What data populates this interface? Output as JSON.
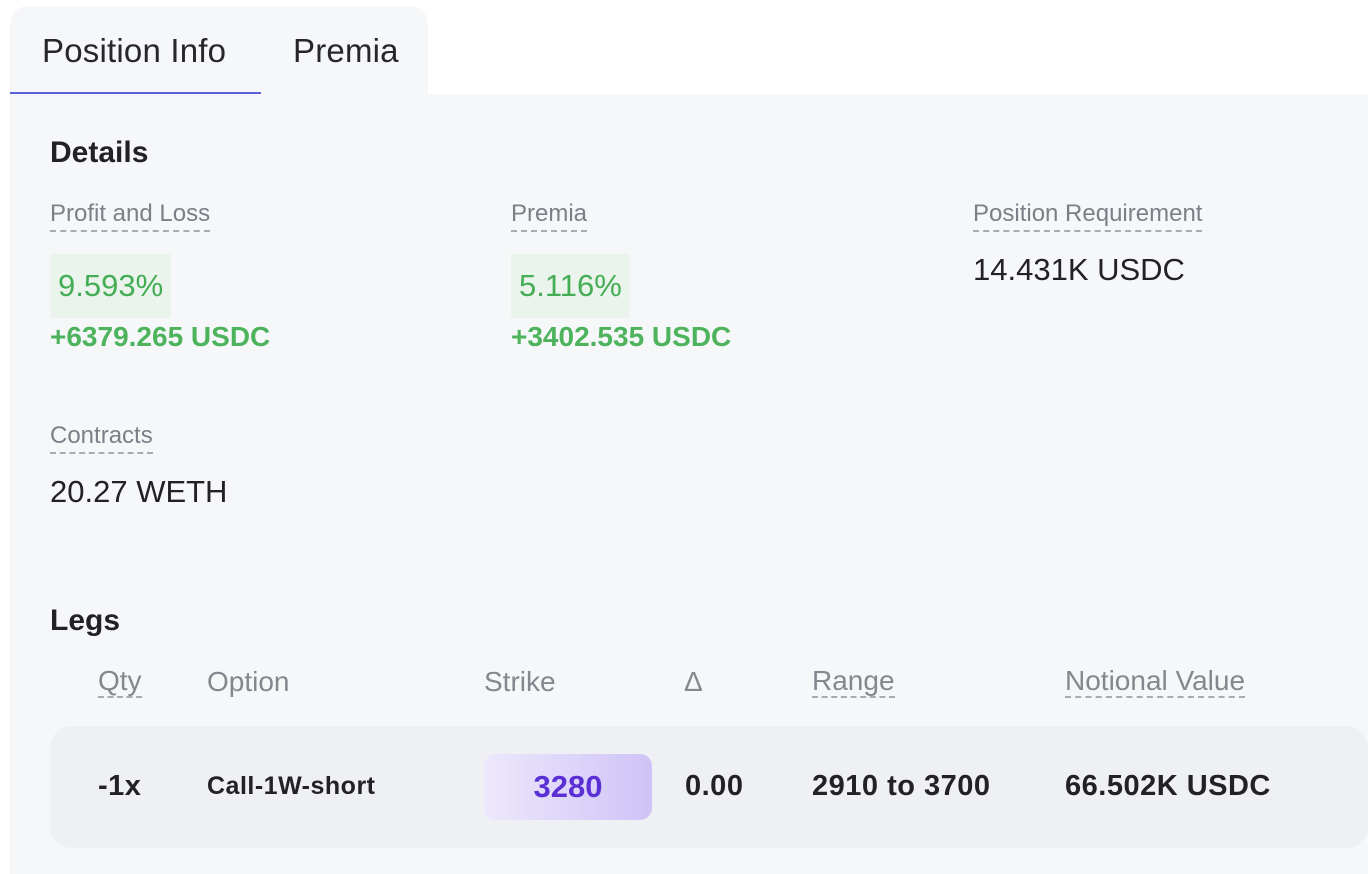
{
  "tabs": {
    "position_info": "Position Info",
    "premia": "Premia",
    "active": "Position Info"
  },
  "details": {
    "title": "Details",
    "pnl": {
      "label": "Profit and Loss",
      "percent": "9.593%",
      "amount": "+6379.265 USDC"
    },
    "premia": {
      "label": "Premia",
      "percent": "5.116%",
      "amount": "+3402.535 USDC"
    },
    "position_requirement": {
      "label": "Position Requirement",
      "value": "14.431K USDC"
    },
    "contracts": {
      "label": "Contracts",
      "value": "20.27 WETH"
    }
  },
  "legs": {
    "title": "Legs",
    "columns": {
      "qty": "Qty",
      "option": "Option",
      "strike": "Strike",
      "delta": "Δ",
      "range": "Range",
      "notional": "Notional Value"
    },
    "rows": [
      {
        "qty": "-1x",
        "option": "Call-1W-short",
        "strike": "3280",
        "delta": "0.00",
        "range": "2910 to 3700",
        "notional": "66.502K USDC"
      }
    ]
  },
  "colors": {
    "accent": "#5b5fd9",
    "positive": "#4db35c",
    "strike": "#5a2fd4",
    "panel_bg": "#f6f7f9"
  }
}
